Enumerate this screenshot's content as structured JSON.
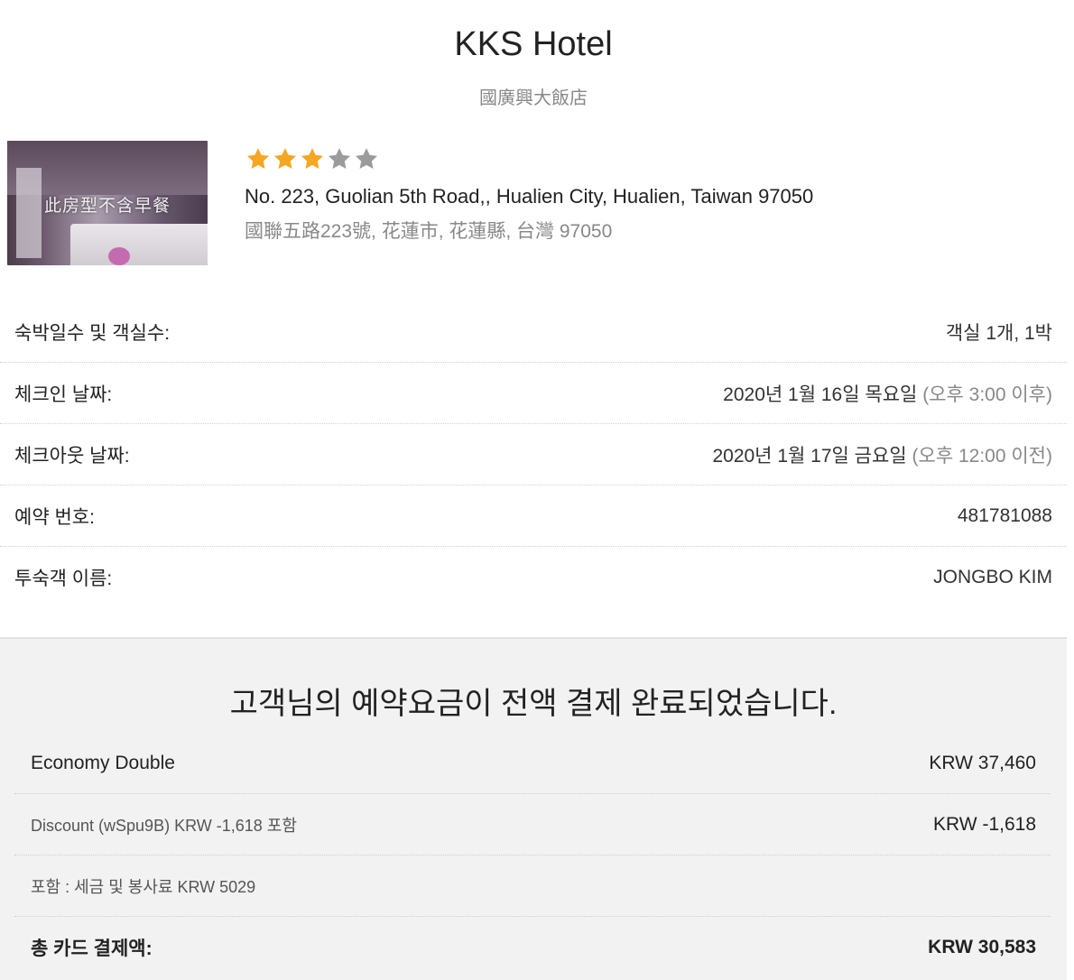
{
  "hotel": {
    "name": "KKS Hotel",
    "local_name": "國廣興大飯店",
    "photo_caption": "此房型不含早餐",
    "rating": 3,
    "max_rating": 5,
    "address_en": "No. 223, Guolian 5th Road,, Hualien City, Hualien, Taiwan 97050",
    "address_local": "國聯五路223號, 花蓮市, 花蓮縣, 台灣 97050"
  },
  "booking": {
    "stay_label": "숙박일수 및 객실수:",
    "stay_value": "객실 1개, 1박",
    "checkin_label": "체크인 날짜:",
    "checkin_date": "2020년 1월 16일 목요일",
    "checkin_time": "(오후 3:00 이후)",
    "checkout_label": "체크아웃 날짜:",
    "checkout_date": "2020년 1월 17일 금요일",
    "checkout_time": "(오후 12:00 이전)",
    "booking_no_label": "예약 번호:",
    "booking_no_value": "481781088",
    "guest_label": "투숙객 이름:",
    "guest_value": "JONGBO KIM"
  },
  "payment": {
    "title": "고객님의 예약요금이 전액 결제 완료되었습니다.",
    "room_type": "Economy Double",
    "room_amount": "KRW 37,460",
    "discount_label": "Discount (wSpu9B) KRW -1,618 포함",
    "discount_amount": "KRW -1,618",
    "tax_label": "포함 : 세금 및 봉사료 KRW 5029",
    "total_label": "총 카드 결제액:",
    "total_amount": "KRW 30,583"
  },
  "colors": {
    "star_filled": "#f5a623",
    "star_empty": "#9b9b9b",
    "payment_bg": "#f2f2f2"
  }
}
